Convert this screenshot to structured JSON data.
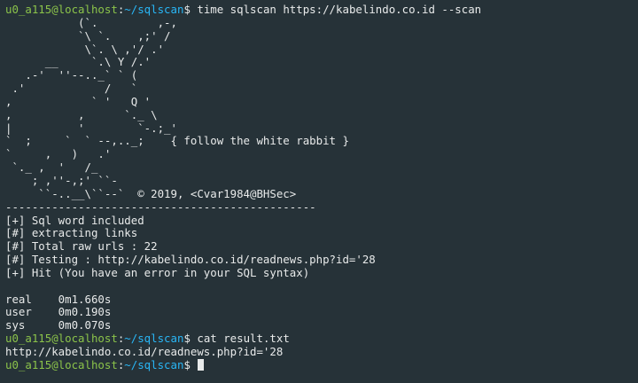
{
  "prompt": {
    "user_host": "u0_a115@localhost",
    "separator": ":",
    "path": "~/sqlscan",
    "symbol": "$"
  },
  "commands": {
    "first": " time sqlscan https://kabelindo.co.id --scan",
    "second": " cat result.txt",
    "third": " "
  },
  "banner": [
    "           (`.         ,-,",
    "           `\\ `.    ,;' /",
    "            \\`. \\ ,'/ .'",
    "      __     `.\\ Y /.'",
    "   .-'  ''--.._` ` (",
    " .'            /   `",
    ",            ` '   Q '",
    ",          ,      `._ \\",
    "|          '        `-.;_'",
    "`  ;     `  ` --,.._;    { follow the white rabbit }",
    "`     ,   )   .'",
    " `._ ,  '   /_",
    "    ; ,''-,;' ``-",
    "     ``-..__\\``--`  © 2019, <Cvar1984@BHSec>"
  ],
  "divider": "-----------------------------------------------",
  "results": [
    "[+] Sql word included",
    "[#] extracting links",
    "[#] Total raw urls : 22",
    "[#] Testing : http://kabelindo.co.id/readnews.php?id='28",
    "[+] Hit (You have an error in your SQL syntax)"
  ],
  "timing": [
    "real    0m1.660s",
    "user    0m0.190s",
    "sys     0m0.070s"
  ],
  "cat_output": "http://kabelindo.co.id/readnews.php?id='28",
  "colors": {
    "background": "#263238",
    "user_host": "#8bc34a",
    "path": "#29b6f6",
    "text": "#e8eaea"
  }
}
